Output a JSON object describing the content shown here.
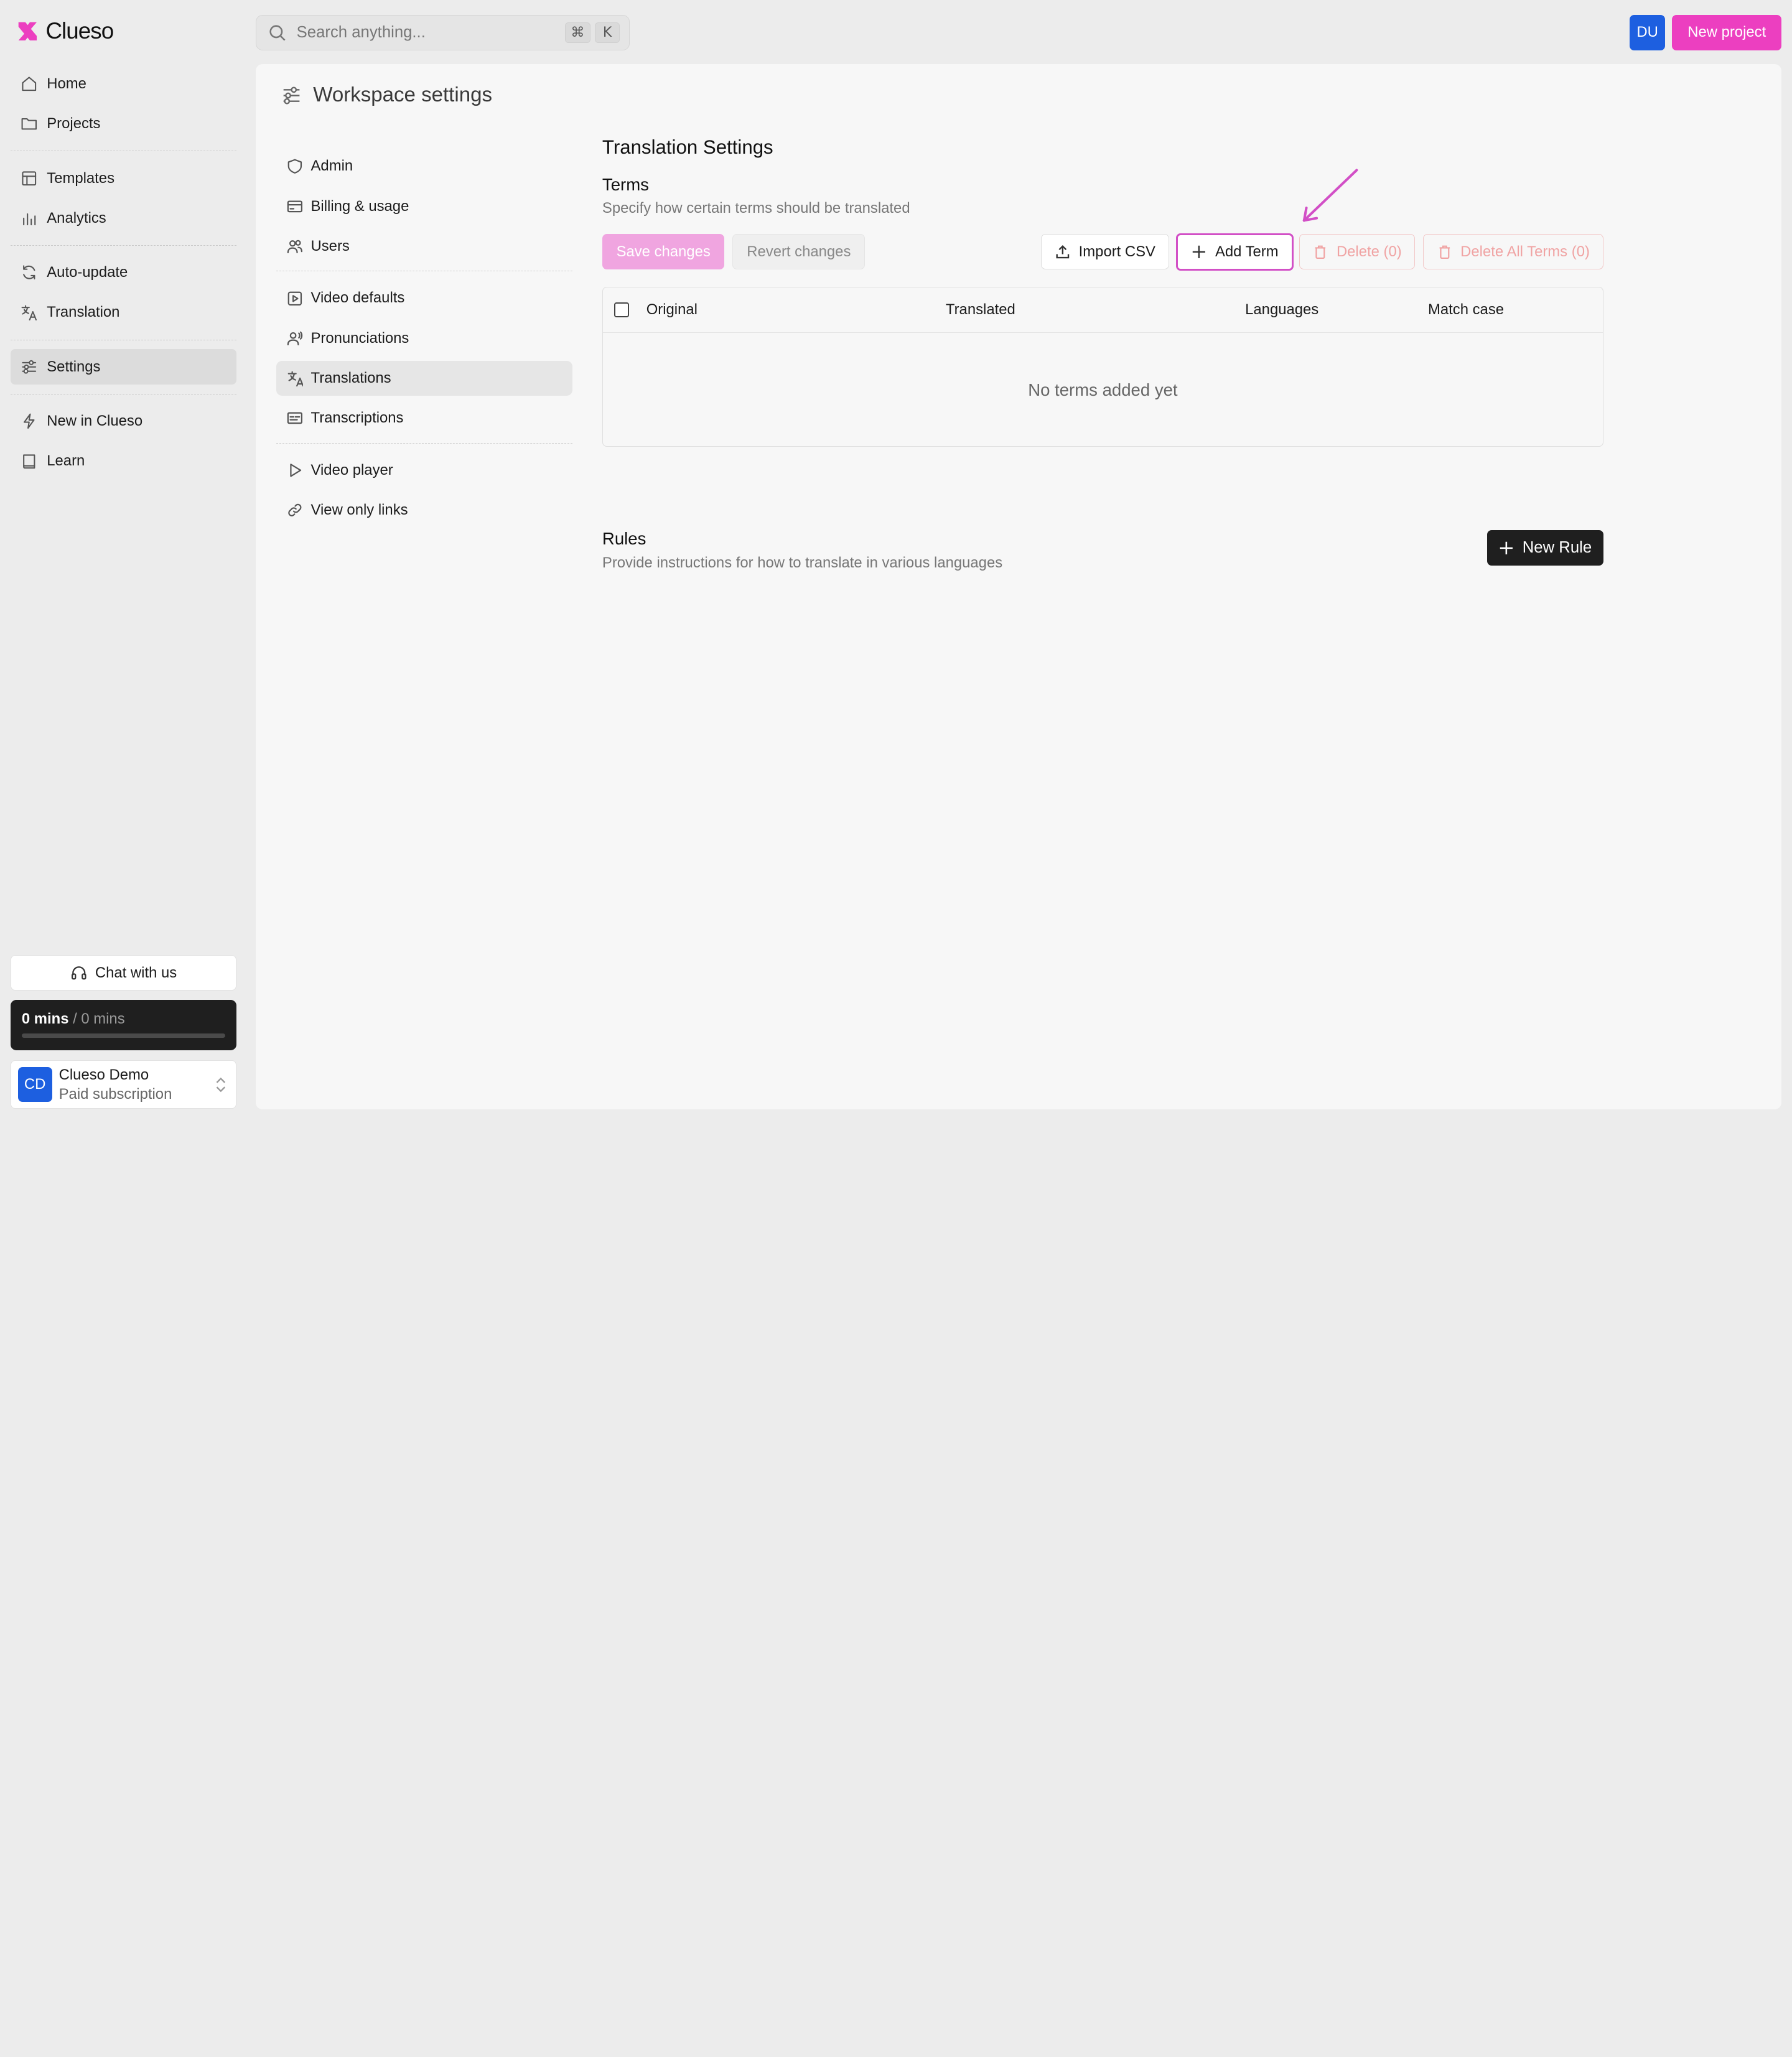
{
  "brand": {
    "name": "Clueso",
    "accent": "#ec3fc0"
  },
  "sidebar": {
    "groups": [
      [
        {
          "label": "Home",
          "icon": "home-icon"
        },
        {
          "label": "Projects",
          "icon": "folder-icon"
        }
      ],
      [
        {
          "label": "Templates",
          "icon": "template-icon"
        },
        {
          "label": "Analytics",
          "icon": "analytics-icon"
        }
      ],
      [
        {
          "label": "Auto-update",
          "icon": "refresh-icon"
        },
        {
          "label": "Translation",
          "icon": "translate-icon"
        }
      ],
      [
        {
          "label": "Settings",
          "icon": "sliders-icon",
          "active": true
        }
      ],
      [
        {
          "label": "New in Clueso",
          "icon": "lightning-icon"
        },
        {
          "label": "Learn",
          "icon": "book-icon"
        }
      ]
    ],
    "chat_label": "Chat with us",
    "usage": {
      "used": "0 mins",
      "separator": " / ",
      "total": "0 mins",
      "fraction": 0
    },
    "account": {
      "initials": "CD",
      "name": "Clueso Demo",
      "plan": "Paid subscription"
    }
  },
  "topbar": {
    "search_placeholder": "Search anything...",
    "shortcut": [
      "⌘",
      "K"
    ],
    "user_initials": "DU",
    "new_project_label": "New project"
  },
  "workspace": {
    "title": "Workspace settings",
    "nav_groups": [
      [
        {
          "label": "Admin",
          "icon": "shield-icon"
        },
        {
          "label": "Billing & usage",
          "icon": "credit-card-icon"
        },
        {
          "label": "Users",
          "icon": "users-icon"
        }
      ],
      [
        {
          "label": "Video defaults",
          "icon": "video-icon"
        },
        {
          "label": "Pronunciations",
          "icon": "speaker-user-icon"
        },
        {
          "label": "Translations",
          "icon": "translate-icon",
          "active": true
        },
        {
          "label": "Transcriptions",
          "icon": "captions-icon"
        }
      ],
      [
        {
          "label": "Video player",
          "icon": "play-icon"
        },
        {
          "label": "View only links",
          "icon": "link-icon"
        }
      ]
    ]
  },
  "translation": {
    "title": "Translation Settings",
    "terms_title": "Terms",
    "terms_subtitle": "Specify how certain terms should be translated",
    "save_label": "Save changes",
    "revert_label": "Revert changes",
    "import_label": "Import CSV",
    "add_term_label": "Add Term",
    "delete_label": "Delete (0)",
    "delete_all_label": "Delete All Terms (0)",
    "columns": [
      "Original",
      "Translated",
      "Languages",
      "Match case"
    ],
    "empty_text": "No terms added yet",
    "rules_title": "Rules",
    "rules_subtitle": "Provide instructions for how to translate in various languages",
    "new_rule_label": "New Rule"
  }
}
